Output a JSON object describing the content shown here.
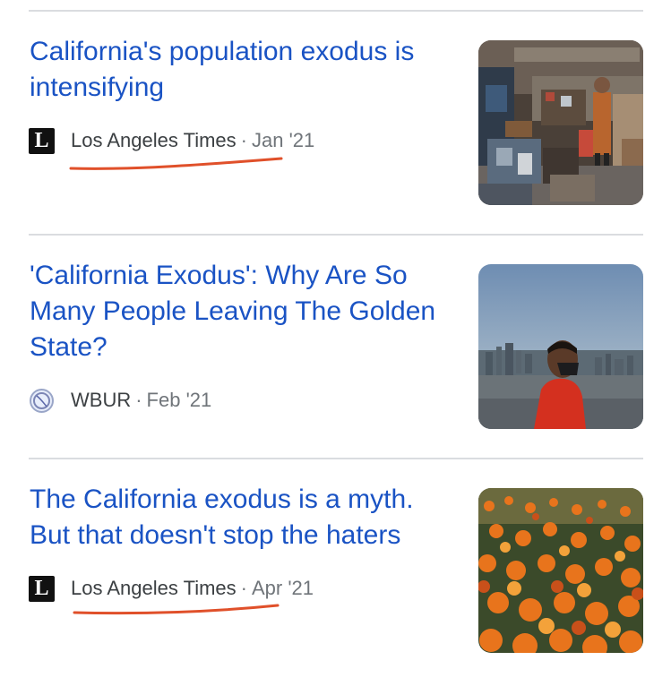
{
  "articles": [
    {
      "title": "California's population exodus is intensifying",
      "publisher": "Los Angeles Times",
      "separator": "·",
      "date": "Jan '21",
      "favicon": "lat-logo-icon",
      "logo_glyph": "L",
      "thumbnail": "cluttered-garage-photo"
    },
    {
      "title": "'California Exodus': Why Are So Many People Leaving The Golden State?",
      "publisher": "WBUR",
      "separator": "·",
      "date": "Feb '21",
      "favicon": "globe-icon",
      "thumbnail": "masked-man-skyline-photo"
    },
    {
      "title": "The California exodus is a myth. But that doesn't stop the haters",
      "publisher": "Los Angeles Times",
      "separator": "·",
      "date": "Apr '21",
      "favicon": "lat-logo-icon",
      "logo_glyph": "L",
      "thumbnail": "orange-poppies-photo"
    }
  ],
  "colors": {
    "title_link": "#1a53c4",
    "publisher_text": "#3c4043",
    "meta_text": "#70757a",
    "divider": "#dadce0",
    "annotation_underline": "#e0502a"
  }
}
